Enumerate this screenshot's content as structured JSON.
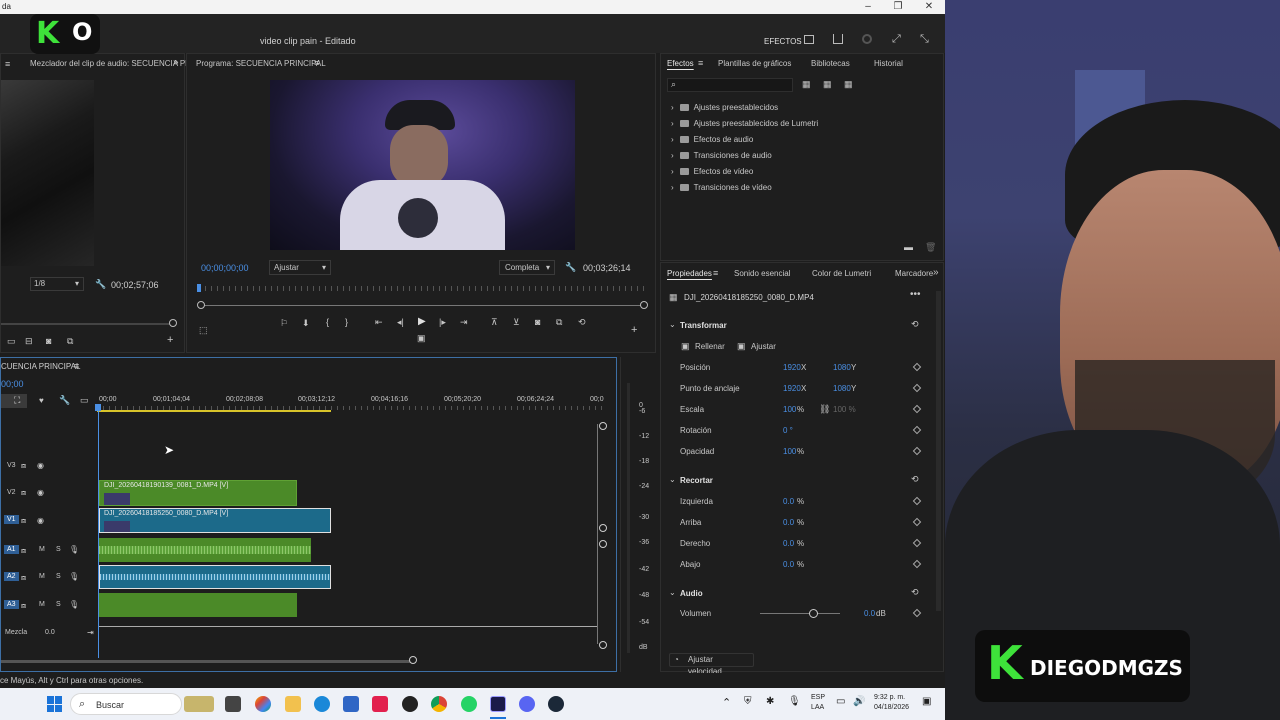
{
  "overlay_logo": {
    "letter_k": "K",
    "letter_o": "O"
  },
  "window": {
    "title_fragment": "da",
    "controls": {
      "minimize": "–",
      "maximize": "❐",
      "close": "✕"
    }
  },
  "app": {
    "title": "video clip pain",
    "title_sep": " - ",
    "title_status": "Editado",
    "workspace_label": "EFECTOS"
  },
  "source_panel": {
    "title": "Mezclador del clip de audio: SECUENCIA PR",
    "resolution": "1/8",
    "timecode": "00;02;57;06"
  },
  "program_monitor": {
    "title": "Programa: SECUENCIA PRINCIPAL",
    "timecode_current": "00;00;00;00",
    "fit_option": "Ajustar",
    "quality_option": "Completa",
    "timecode_duration": "00;03;26;14"
  },
  "effects_panel": {
    "tabs": [
      "Efectos",
      "Plantillas de gráficos",
      "Bibliotecas",
      "Historial"
    ],
    "search_placeholder": "",
    "items": [
      "Ajustes preestablecidos",
      "Ajustes preestablecidos de Lumetri",
      "Efectos de audio",
      "Transiciones de audio",
      "Efectos de vídeo",
      "Transiciones de vídeo"
    ]
  },
  "properties_panel": {
    "tabs": [
      "Propiedades",
      "Sonido esencial",
      "Color de Lumetri",
      "Marcadore"
    ],
    "clip_name": "DJI_20260418185250_0080_D.MP4",
    "transform": {
      "section": "Transformar",
      "fill_label": "Rellenar",
      "fit_label": "Ajustar",
      "position_label": "Posición",
      "position_x": "1920",
      "position_y": "1080",
      "anchor_label": "Punto de anclaje",
      "anchor_x": "1920",
      "anchor_y": "1080",
      "x_unit": "X",
      "y_unit": "Y",
      "scale_label": "Escala",
      "scale_value": "100",
      "scale_value_2": "100 %",
      "percent": "%",
      "rotation_label": "Rotación",
      "rotation_value": "0 °",
      "opacity_label": "Opacidad",
      "opacity_value": "100"
    },
    "crop": {
      "section": "Recortar",
      "left_label": "Izquierda",
      "left_value": "0.0",
      "top_label": "Arriba",
      "top_value": "0.0",
      "right_label": "Derecho",
      "right_value": "0.0",
      "bottom_label": "Abajo",
      "bottom_value": "0.0"
    },
    "audio": {
      "section": "Audio",
      "volume_label": "Volumen",
      "volume_value": "0.0",
      "volume_unit": "dB",
      "volume_level": 0.68
    },
    "speed_button": "Ajustar velocidad..."
  },
  "timeline": {
    "title": "CUENCIA PRINCIPAL",
    "timecode": "00;00",
    "ruler": [
      "00;00",
      "00;01;04;04",
      "00;02;08;08",
      "00;03;12;12",
      "00;04;16;16",
      "00;05;20;20",
      "00;06;24;24",
      "00;0"
    ],
    "tracks_video": [
      {
        "id": "V3"
      },
      {
        "id": "V2",
        "clip": "DJI_20260418190139_0081_D.MP4 [V]"
      },
      {
        "id": "V1",
        "clip": "DJI_20260418185250_0080_D.MP4 [V]"
      }
    ],
    "tracks_audio": [
      {
        "id": "A1",
        "m": "M",
        "s": "S"
      },
      {
        "id": "A2",
        "m": "M",
        "s": "S"
      },
      {
        "id": "A3",
        "m": "M",
        "s": "S"
      }
    ],
    "mix_label": "Mezcla",
    "mix_value": "0.0"
  },
  "meter_scale": [
    "0",
    "-6",
    "-12",
    "-18",
    "-24",
    "-30",
    "-36",
    "-42",
    "-48",
    "-54",
    "dB"
  ],
  "status_bar": "ce Mayús, Alt y Ctrl para otras opciones.",
  "taskbar": {
    "search_label": "Buscar",
    "lang_1": "ESP",
    "lang_2": "LAA",
    "time": "9:32 p. m.",
    "date": "04/18/2026"
  },
  "webcam_badge": {
    "letter": "K",
    "name": "DIEGODMGZS"
  },
  "colors": {
    "accent_blue": "#4a8fe4",
    "clip_green": "#4b8a28",
    "clip_teal": "#1c6a8a",
    "brand_green": "#3ee23a"
  }
}
